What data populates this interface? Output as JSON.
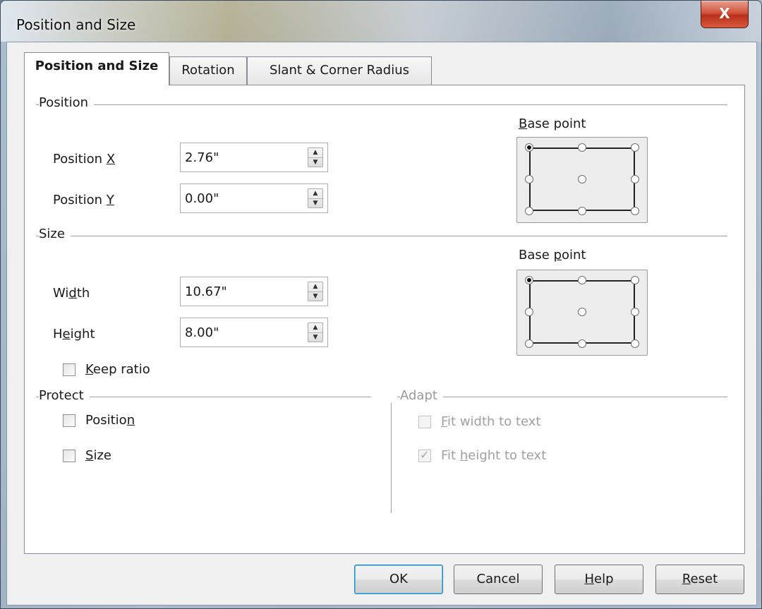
{
  "window": {
    "title": "Position and Size",
    "close_label": "X"
  },
  "tabs": [
    {
      "label": "Position and Size",
      "active": true
    },
    {
      "label": "Rotation",
      "active": false
    },
    {
      "label": "Slant & Corner Radius",
      "active": false
    }
  ],
  "position": {
    "section_label": "Position",
    "x": {
      "label_pre": "Position ",
      "label_acc": "X",
      "value": "2.76\""
    },
    "y": {
      "label_pre": "Position ",
      "label_acc": "Y",
      "value": "0.00\""
    },
    "base_point": {
      "label_acc": "B",
      "label_rest": "ase point",
      "selected": "top-left"
    }
  },
  "size": {
    "section_label": "Size",
    "width": {
      "label_pre": "Wi",
      "label_acc": "d",
      "label_post": "th",
      "value": "10.67\""
    },
    "height": {
      "label_pre": "H",
      "label_acc": "e",
      "label_post": "ight",
      "value": "8.00\""
    },
    "keep_ratio": {
      "label_acc": "K",
      "label_rest": "eep ratio",
      "checked": false
    },
    "base_point": {
      "label_pre": "Base ",
      "label_acc": "p",
      "label_rest": "oint",
      "selected": "top-left"
    }
  },
  "protect": {
    "section_label": "Protect",
    "position": {
      "label_pre": "Positio",
      "label_acc": "n",
      "checked": false
    },
    "size": {
      "label_acc": "S",
      "label_rest": "ize",
      "checked": false
    }
  },
  "adapt": {
    "section_label": "Adapt",
    "fit_width": {
      "label_acc": "F",
      "label_rest": "it width to text",
      "checked": false,
      "enabled": false
    },
    "fit_height": {
      "label_pre": "Fit ",
      "label_acc": "h",
      "label_rest": "eight to text",
      "checked": true,
      "enabled": false
    }
  },
  "buttons": {
    "ok": "OK",
    "cancel": "Cancel",
    "help": {
      "label_acc": "H",
      "label_rest": "elp"
    },
    "reset": {
      "label_acc": "R",
      "label_rest": "eset"
    }
  }
}
